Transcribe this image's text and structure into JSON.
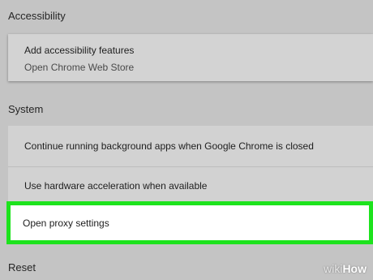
{
  "sections": {
    "accessibility": {
      "title": "Accessibility",
      "card": {
        "title": "Add accessibility features",
        "subtitle": "Open Chrome Web Store"
      }
    },
    "system": {
      "title": "System",
      "rows": [
        {
          "label": "Continue running background apps when Google Chrome is closed"
        },
        {
          "label": "Use hardware acceleration when available"
        },
        {
          "label": "Open proxy settings"
        }
      ]
    },
    "reset": {
      "title": "Reset"
    }
  },
  "highlight_color": "#1de31d",
  "watermark": {
    "wiki": "wiki",
    "how": "How"
  }
}
